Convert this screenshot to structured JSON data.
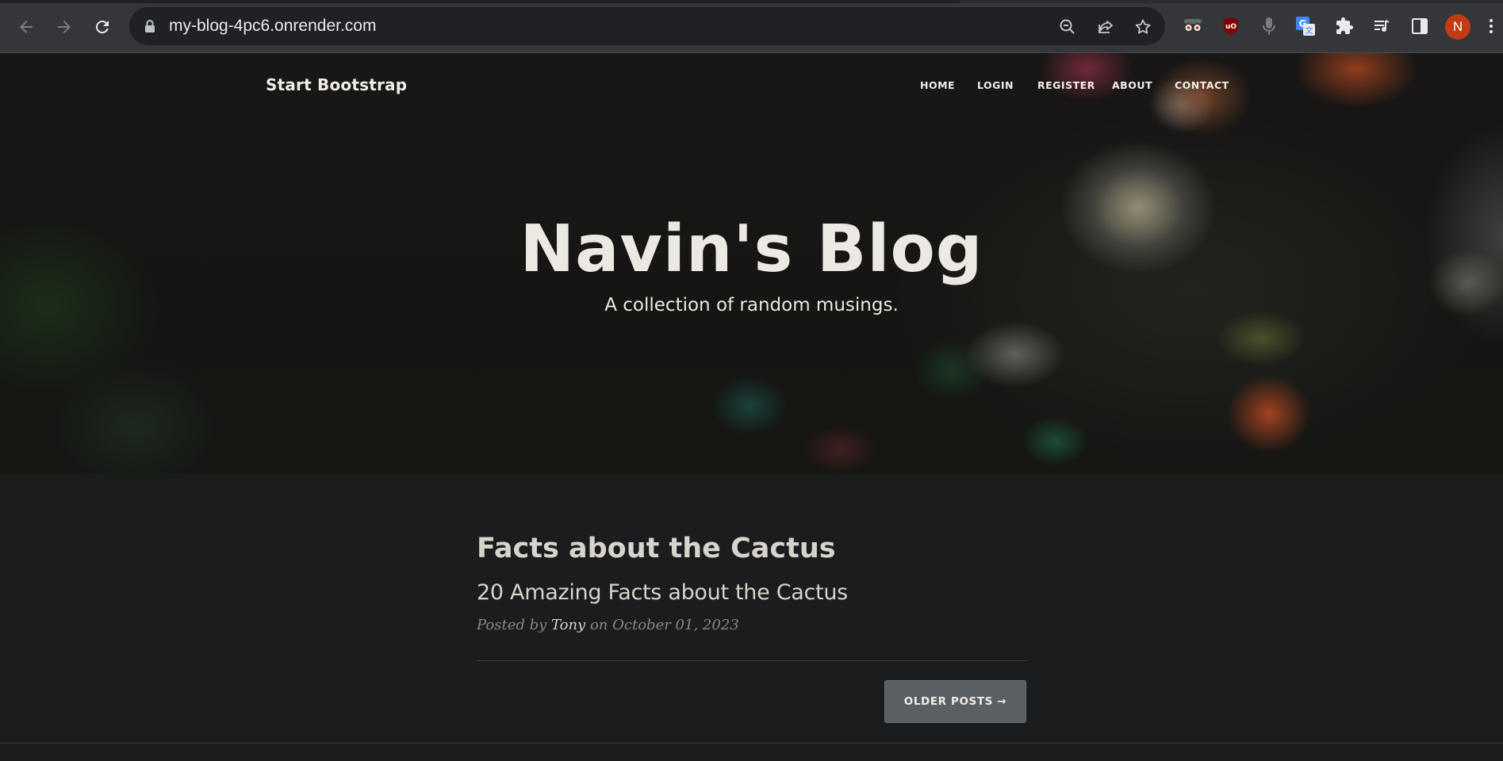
{
  "browser": {
    "url": "my-blog-4pc6.onrender.com",
    "profile_initial": "N",
    "icons": [
      "back-icon",
      "forward-icon",
      "reload-icon",
      "lock-icon",
      "zoom-out-icon",
      "share-icon",
      "bookmark-star-icon",
      "extension-glasses-icon",
      "ublock-icon",
      "microphone-icon",
      "translate-icon",
      "puzzle-extensions-icon",
      "media-queue-icon",
      "side-panel-icon",
      "more-vert-icon"
    ]
  },
  "site": {
    "brand": "Start Bootstrap",
    "nav": [
      {
        "label": "HOME"
      },
      {
        "label": "LOGIN"
      },
      {
        "label": "REGISTER"
      },
      {
        "label": "ABOUT"
      },
      {
        "label": "CONTACT"
      }
    ],
    "hero": {
      "title": "Navin's Blog",
      "subtitle": "A collection of random musings."
    }
  },
  "posts": [
    {
      "title": "Facts about the Cactus",
      "subtitle": "20 Amazing Facts about the Cactus",
      "meta_prefix": "Posted by",
      "author": "Tony",
      "meta_on": "on",
      "date": "October 01, 2023"
    }
  ],
  "pager": {
    "older_label": "OLDER POSTS →"
  },
  "colors": {
    "page_bg": "#1b1c1e",
    "button_bg": "#5a5f63",
    "avatar_bg": "#c23b13"
  }
}
